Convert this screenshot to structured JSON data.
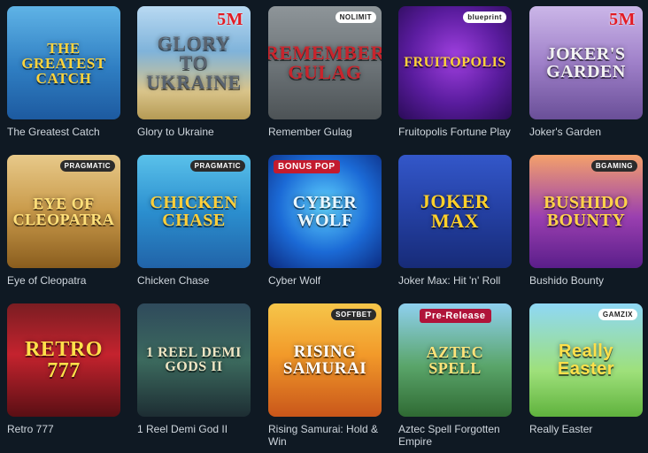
{
  "games": [
    {
      "title": "The Greatest Catch",
      "art": "THE GREATEST CATCH",
      "badge": "",
      "bg": "linear-gradient(180deg,#5fb3e6 0%,#2f7ec2 55%,#1d5aa0 100%)",
      "fg": "#ffd43b"
    },
    {
      "title": "Glory to Ukraine",
      "art": "GLORY TO UKRAINE",
      "badge": "5M",
      "bg": "linear-gradient(180deg,#b8d9f2 0%,#7fb3da 40%,#d9c48a 75%,#b59a54 100%)",
      "fg": "#5a6470"
    },
    {
      "title": "Remember Gulag",
      "art": "REMEMBER GULAG",
      "badge": "NOLIMIT",
      "bg": "linear-gradient(180deg,#8e9599 0%,#6b7276 55%,#4d5356 100%)",
      "fg": "#c9242c"
    },
    {
      "title": "Fruitopolis Fortune Play",
      "art": "FRUITOPOLIS",
      "badge": "blueprint",
      "bg": "radial-gradient(circle at 50% 45%,#a040e0 0%,#5a1c9e 55%,#2a0b57 100%)",
      "fg": "#ffd23a"
    },
    {
      "title": "Joker's Garden",
      "art": "JOKER'S GARDEN",
      "badge": "5M",
      "bg": "linear-gradient(180deg,#cbb6e8 0%,#9f80c9 50%,#6a4f98 100%)",
      "fg": "#f2f2f2"
    },
    {
      "title": "Eye of Cleopatra",
      "art": "EYE OF CLEOPATRA",
      "badge": "PRAGMATIC",
      "bg": "linear-gradient(180deg,#e7c98a 0%,#c99a4a 50%,#8a5d1e 100%)",
      "fg": "#ffe07a"
    },
    {
      "title": "Chicken Chase",
      "art": "CHICKEN CHASE",
      "badge": "PRAGMATIC",
      "bg": "linear-gradient(180deg,#5ac1ea 0%,#2b8fcf 50%,#2163a8 100%)",
      "fg": "#ffcf3a"
    },
    {
      "title": "Cyber Wolf",
      "art": "CYBER WOLF",
      "badge": "BONUS POP",
      "bg": "radial-gradient(circle at 50% 45%,#5fd3ff 0%,#1b6ad6 55%,#0c2b80 100%)",
      "fg": "#eaf7ff"
    },
    {
      "title": "Joker Max: Hit 'n' Roll",
      "art": "JOKER MAX",
      "badge": "",
      "bg": "linear-gradient(180deg,#3357c9 0%,#2440a3 50%,#172b78 100%)",
      "fg": "#ffd02a"
    },
    {
      "title": "Bushido Bounty",
      "art": "BUSHIDO BOUNTY",
      "badge": "BGAMING",
      "bg": "linear-gradient(180deg,#f4a16a 0%,#9a3fb0 55%,#5a1e8a 100%)",
      "fg": "#ffd24a"
    },
    {
      "title": "Retro 777",
      "art": "RETRO 777",
      "badge": "",
      "bg": "linear-gradient(180deg,#7a1d22 0%,#c4232e 45%,#5a0f14 100%)",
      "fg": "#ffe04a"
    },
    {
      "title": "1 Reel Demi God II",
      "art": "1 REEL DEMI GODS II",
      "badge": "",
      "bg": "linear-gradient(180deg,#2f4a5c 0%,#3c6a5e 50%,#1d2d33 100%)",
      "fg": "#efe6c4"
    },
    {
      "title": "Rising Samurai: Hold & Win",
      "art": "RISING SAMURAI",
      "badge": "SOFTBET",
      "bg": "linear-gradient(180deg,#f6c64a 0%,#f29a2a 45%,#c9561a 100%)",
      "fg": "#ffffff"
    },
    {
      "title": "Aztec Spell Forgotten Empire",
      "art": "AZTEC SPELL",
      "badge": "Pre-Release",
      "bg": "linear-gradient(180deg,#8fd0ef 0%,#5aa56a 55%,#2f6a33 100%)",
      "fg": "#ffe37a"
    },
    {
      "title": "Really Easter",
      "art": "Really Easter",
      "badge": "GAMZIX",
      "bg": "linear-gradient(180deg,#8fd8f6 0%,#9ee07a 60%,#5fb23d 100%)",
      "fg": "#ffe04a"
    }
  ]
}
